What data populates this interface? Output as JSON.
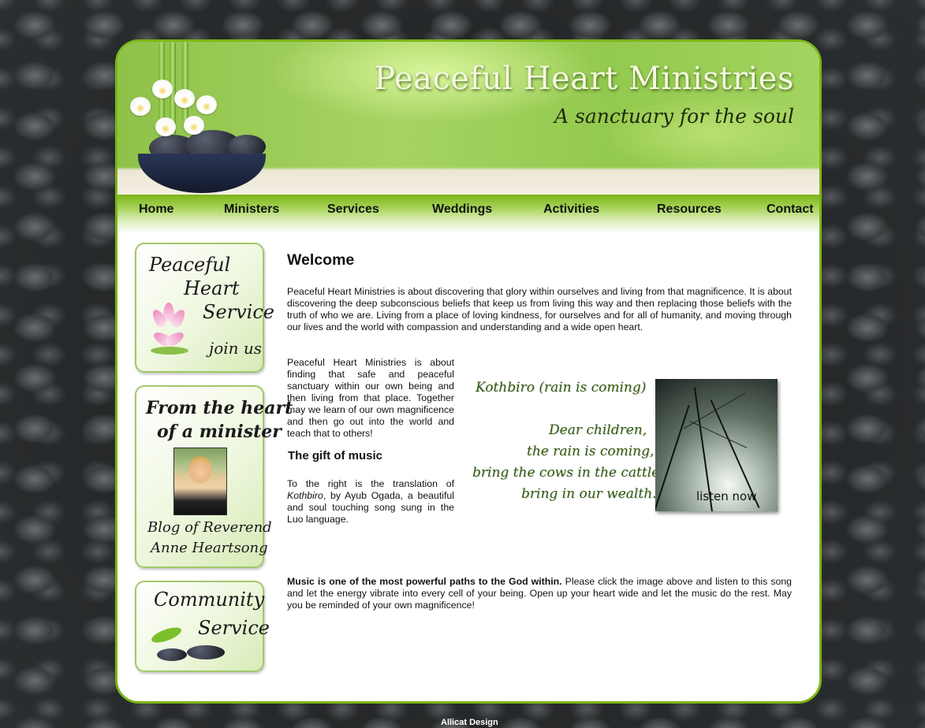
{
  "site": {
    "title": "Peaceful Heart Ministries",
    "tagline": "A sanctuary for the soul"
  },
  "nav": {
    "items": [
      {
        "label": "Home"
      },
      {
        "label": "Ministers"
      },
      {
        "label": "Services"
      },
      {
        "label": "Weddings"
      },
      {
        "label": "Activities"
      },
      {
        "label": "Resources"
      },
      {
        "label": "Contact"
      }
    ]
  },
  "sidebar": {
    "service": {
      "line1": "Peaceful",
      "line2": "Heart",
      "line3": "Service",
      "cta": "join us"
    },
    "blog": {
      "line1": "From the heart",
      "line2": "of a minister",
      "line3": "Blog of Reverend",
      "line4": "Anne Heartsong"
    },
    "community": {
      "line1": "Community",
      "line2": "Service"
    }
  },
  "main": {
    "heading": "Welcome",
    "intro": "Peaceful Heart Ministries is about discovering that glory within ourselves and living from that magnificence. It is about discovering the deep subconscious beliefs that keep us from living this way and then replacing those beliefs with the truth of who we are. Living from a place of loving kindness, for ourselves and for all of humanity, and moving through our lives and the world with compassion and understanding and a wide open heart.",
    "paragraph2": "Peaceful Heart Ministries is about finding that safe and peaceful sanctuary within our own being and then living from that place. Together may we learn of our own magnificence and then go out into the world and teach that to others!",
    "music_heading": "The gift of music",
    "music_text_before": "To the right is the translation of ",
    "music_text_italic": "Kothbiro",
    "music_text_after": ", by Ayub Ogada, a beautiful and soul touching song sung in the Luo language.",
    "closing_bold": "Music is one of the most powerful paths to the God within.",
    "closing_text": " Please click the image above and listen to this song and let the energy vibrate into every cell of your being. Open up your heart wide and let the music do the rest. May you be reminded of your own magnificence!"
  },
  "music_image": {
    "title": "Kothbiro (rain is coming)",
    "lyrics": [
      "Dear children,",
      "the rain is coming,",
      "bring the cows in the cattle,",
      "bring in our wealth."
    ],
    "listen_label": "listen now"
  },
  "footer": {
    "credit": "Allicat Design"
  },
  "colors": {
    "accent": "#7cb518",
    "lyric_green": "#2f5a0e",
    "sidebar_border": "#a3c86a"
  }
}
